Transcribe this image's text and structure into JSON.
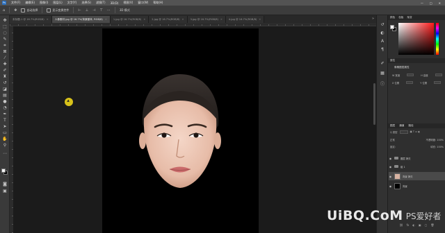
{
  "menubar": {
    "logo": "Ps",
    "items": [
      "文件(F)",
      "编辑(E)",
      "图像(I)",
      "图层(L)",
      "文字(Y)",
      "选择(S)",
      "滤镜(T)",
      "3D(D)",
      "视图(V)",
      "窗口(W)",
      "帮助(H)"
    ],
    "window_controls": [
      "—",
      "□",
      "✕"
    ]
  },
  "options_bar": {
    "home_glyph": "⌂",
    "tool_glyph": "✥",
    "auto_select_label": "自动选择",
    "transform_controls_label": "显示变换控件",
    "mode_label": "3D 模式"
  },
  "tabs": [
    {
      "label": "未标题-1 @ 16.7%(RGB/8)",
      "active": false
    },
    {
      "label": "人像素材.jpg @ 16.7%(背景副本, RGB/8)",
      "active": true
    },
    {
      "label": "1.jpg @ 16.7%(RGB/8)",
      "active": false
    },
    {
      "label": "2.jpg @ 16.7%(RGB/8)",
      "active": false
    },
    {
      "label": "3.jpg @ 16.7%(RGB/8)",
      "active": false
    },
    {
      "label": "4.jpg @ 16.7%(RGB/8)",
      "active": false
    },
    {
      "label": "5.jpg @ 16.7%(RGB/8)",
      "active": false
    }
  ],
  "tab_overflow": "»",
  "panels": {
    "color_tabs": [
      "颜色",
      "色板",
      "渐变"
    ],
    "properties_header": "属性",
    "properties_title": "像素图层属性",
    "properties_rows": [
      {
        "a": "W 宽度",
        "b": "H 高度"
      },
      {
        "a": "X 位置",
        "b": "Y 位置"
      }
    ],
    "layers_tabs": [
      "图层",
      "通道",
      "路径"
    ],
    "layers_filter_label": "Q 类型",
    "blend_mode": "正常",
    "opacity_label": "不透明度: 100%",
    "lock_label": "锁定:",
    "fill_label": "填充: 100%",
    "layers": [
      {
        "name": "图层 拷贝",
        "type": "folder",
        "selected": false
      },
      {
        "name": "组 1",
        "type": "folder",
        "selected": false
      },
      {
        "name": "背景 拷贝",
        "type": "face",
        "selected": true
      },
      {
        "name": "背景",
        "type": "black",
        "selected": false
      }
    ],
    "layers_footer": [
      "⛓",
      "fx",
      "◐",
      "▣",
      "▢",
      "🗑"
    ]
  },
  "watermark": {
    "text": "UiBQ.CoM",
    "sub": "PS爱好者"
  },
  "colors": {
    "accent_cursor": "#d8c21a",
    "canvas": "#000000",
    "workspace": "#1b1b1b"
  }
}
